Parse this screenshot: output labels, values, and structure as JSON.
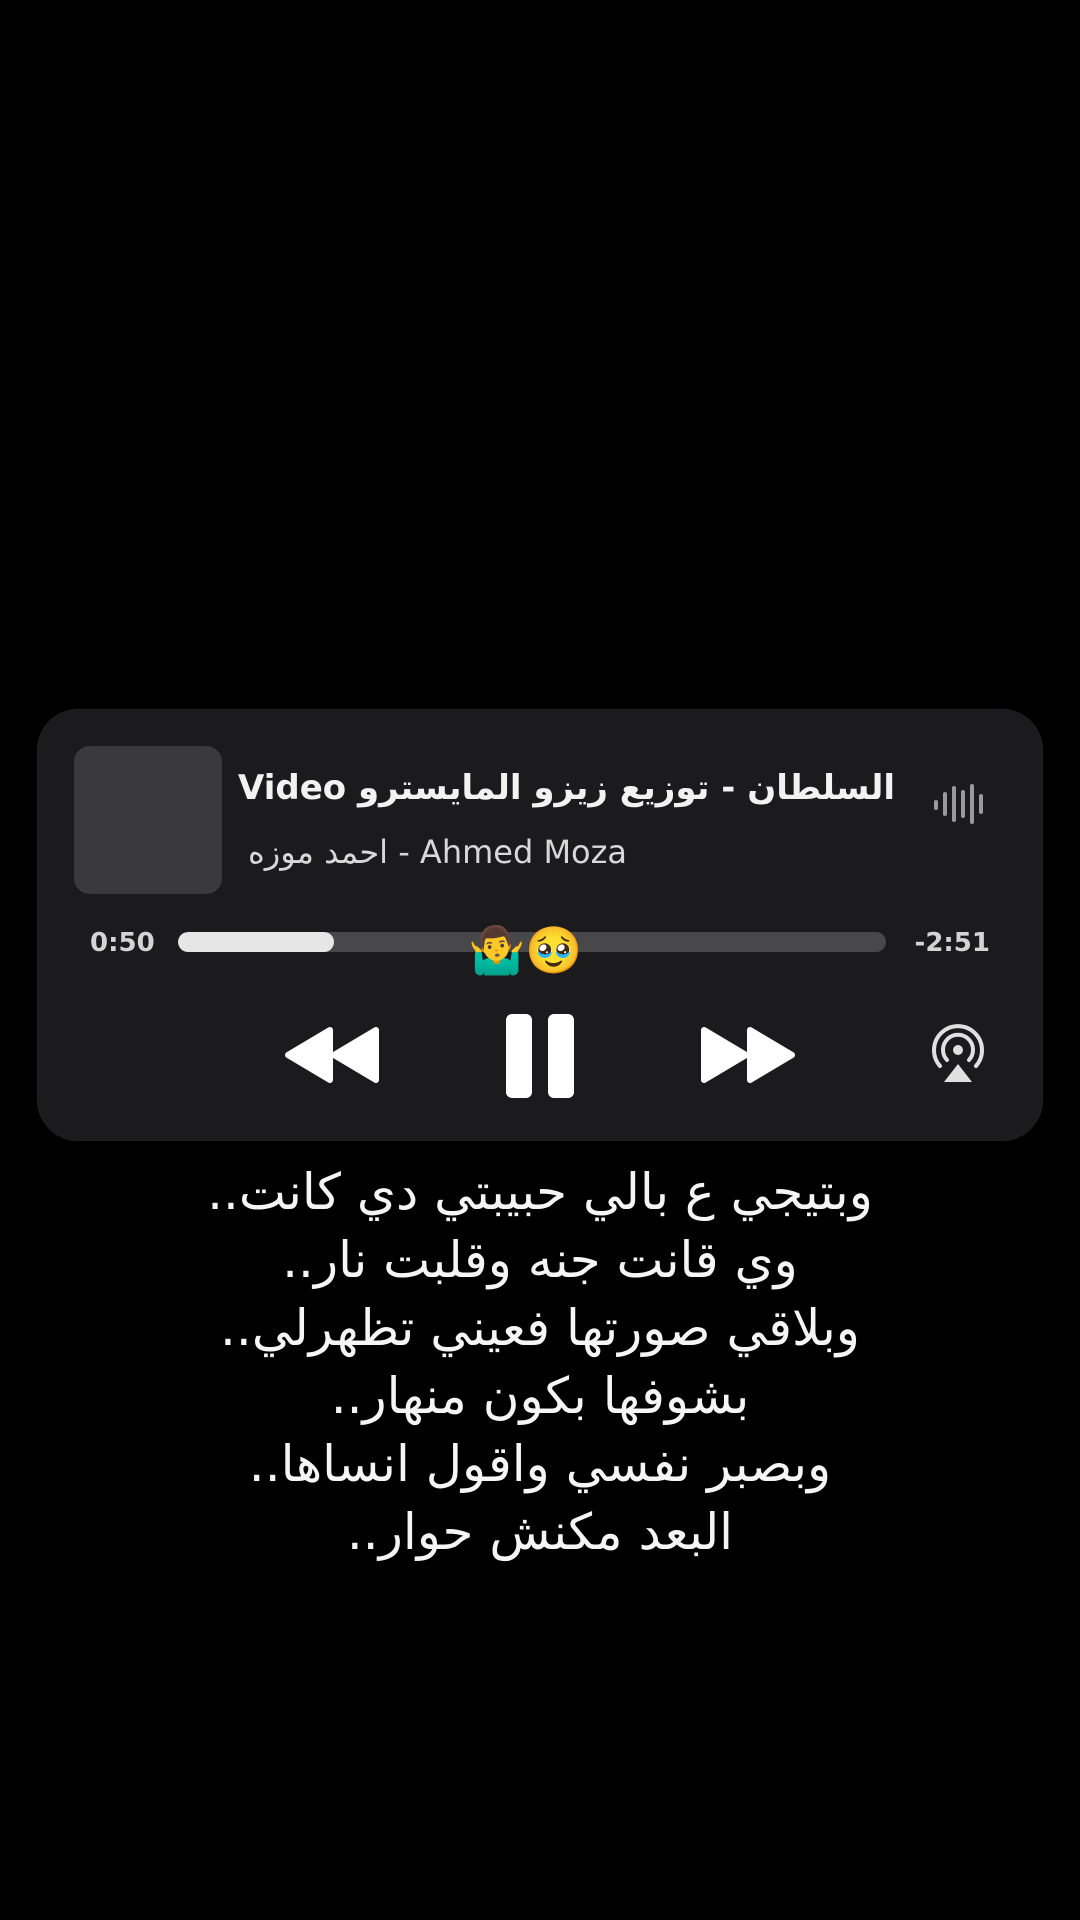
{
  "player": {
    "title": "السلطان - توزيع زيزو المايسترو Video",
    "artist": "احمد موزه - Ahmed Moza",
    "elapsed": "0:50",
    "remaining": "-2:51",
    "progress_fraction": 0.22,
    "icons": {
      "waveform": "waveform-icon",
      "rewind": "rewind-icon",
      "pause": "pause-icon",
      "forward": "fast-forward-icon",
      "airplay": "airplay-icon"
    },
    "accent_color": "#e6e6e6",
    "background_color": "#1b1b1d"
  },
  "sticker": {
    "emojis": "🤷‍♂️🥹"
  },
  "lyrics": [
    "وبتيجي ع بالي حبيبتي دي كانت..",
    "وي قانت جنه وقلبت نار..",
    "وبلاقي صورتها فعيني تظهرلي..",
    "بشوفها بكون منهار..",
    "وبصبر نفسي واقول انساها..",
    "البعد مكنش حوار.."
  ]
}
